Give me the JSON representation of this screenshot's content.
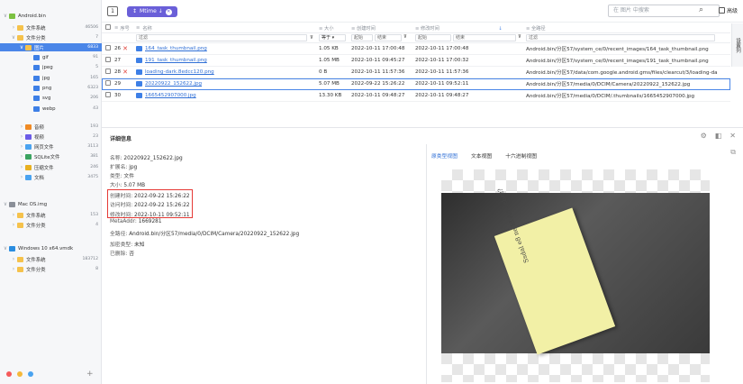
{
  "sidebar": {
    "tree": [
      {
        "label": "Android.bin",
        "count": "",
        "indent": 0,
        "chev": "∨",
        "icon": "android",
        "selected": false
      },
      {
        "label": "文件系统",
        "count": "46506",
        "indent": 1,
        "chev": "›",
        "icon": "folder",
        "selected": false
      },
      {
        "label": "文件分类",
        "count": "7",
        "indent": 1,
        "chev": "∨",
        "icon": "folder",
        "selected": false
      },
      {
        "label": "图片",
        "count": "6833",
        "indent": 2,
        "chev": "∨",
        "icon": "folder",
        "selected": true
      },
      {
        "label": "gif",
        "count": "91",
        "indent": 3,
        "chev": "",
        "icon": "image",
        "selected": false
      },
      {
        "label": "jpeg",
        "count": "5",
        "indent": 3,
        "chev": "",
        "icon": "image",
        "selected": false
      },
      {
        "label": "jpg",
        "count": "165",
        "indent": 3,
        "chev": "",
        "icon": "image",
        "selected": false
      },
      {
        "label": "png",
        "count": "6323",
        "indent": 3,
        "chev": "",
        "icon": "image",
        "selected": false
      },
      {
        "label": "svg",
        "count": "206",
        "indent": 3,
        "chev": "",
        "icon": "image",
        "selected": false
      },
      {
        "label": "webp",
        "count": "43",
        "indent": 3,
        "chev": "",
        "icon": "image",
        "selected": false
      },
      {
        "label": "音频",
        "count": "193",
        "indent": 2,
        "chev": "›",
        "icon": "audio",
        "selected": false
      },
      {
        "label": "视频",
        "count": "23",
        "indent": 2,
        "chev": "›",
        "icon": "video",
        "selected": false
      },
      {
        "label": "网页文件",
        "count": "3113",
        "indent": 2,
        "chev": "›",
        "icon": "web",
        "selected": false
      },
      {
        "label": "SQLite文件",
        "count": "381",
        "indent": 2,
        "chev": "›",
        "icon": "sqlite",
        "selected": false
      },
      {
        "label": "压缩文件",
        "count": "246",
        "indent": 2,
        "chev": "›",
        "icon": "zip",
        "selected": false
      },
      {
        "label": "文档",
        "count": "3475",
        "indent": 2,
        "chev": "›",
        "icon": "doc",
        "selected": false
      },
      {
        "label": "Mac OS.img",
        "count": "",
        "indent": 0,
        "chev": "∨",
        "icon": "mac",
        "selected": false
      },
      {
        "label": "文件系统",
        "count": "153",
        "indent": 1,
        "chev": "›",
        "icon": "folder",
        "selected": false
      },
      {
        "label": "文件分类",
        "count": "4",
        "indent": 1,
        "chev": "›",
        "icon": "folder",
        "selected": false
      },
      {
        "label": "Windows 10 x64.vmdk",
        "count": "",
        "indent": 0,
        "chev": "∨",
        "icon": "windows",
        "selected": false
      },
      {
        "label": "文件系统",
        "count": "183712",
        "indent": 1,
        "chev": "›",
        "icon": "folder",
        "selected": false
      },
      {
        "label": "文件分类",
        "count": "8",
        "indent": 1,
        "chev": "›",
        "icon": "folder",
        "selected": false
      }
    ],
    "add_label": "+"
  },
  "toolbar": {
    "view_toggle": "1",
    "filter_chip": "Mtime ↓",
    "search_placeholder": "在 图片 中搜索",
    "adv_search": "高级"
  },
  "table": {
    "headers": {
      "index": "序号",
      "name": "名称",
      "size": "大小",
      "ctime": "创建时间",
      "mtime": "修改时间",
      "path": "全路径"
    },
    "filters": {
      "name": "过滤",
      "size_op": "等于 ▾",
      "start": "起始",
      "end": "结束",
      "path": "过滤"
    },
    "rows": [
      {
        "index": "26",
        "deleted": true,
        "name": "164_task_thumbnail.png",
        "size": "1.05 KB",
        "ctime": "2022-10-11 17:00:48",
        "mtime": "2022-10-11 17:00:48",
        "path": "Android.bin/分区57/system_ce/0/recent_images/164_task_thumbnail.png",
        "selected": false
      },
      {
        "index": "27",
        "deleted": false,
        "name": "191_task_thumbnail.png",
        "size": "1.05 MB",
        "ctime": "2022-10-11 09:45:27",
        "mtime": "2022-10-11 17:00:32",
        "path": "Android.bin/分区57/system_ce/0/recent_images/191_task_thumbnail.png",
        "selected": false
      },
      {
        "index": "28",
        "deleted": true,
        "name": "loading-dark.8edcc120.png",
        "size": "0 B",
        "ctime": "2022-10-11 11:57:36",
        "mtime": "2022-10-11 11:57:36",
        "path": "Android.bin/分区57/data/com.google.android.gms/files/clearcut/3/loading-da",
        "selected": false
      },
      {
        "index": "29",
        "deleted": false,
        "name": "20220922_152622.jpg",
        "size": "5.07 MB",
        "ctime": "2022-09-22 15:26:22",
        "mtime": "2022-10-11 09:52:11",
        "path": "Android.bin/分区57/media/0/DCIM/Camera/20220922_152622.jpg",
        "selected": true
      },
      {
        "index": "30",
        "deleted": false,
        "name": "1665452907000.jpg",
        "size": "13.30 KB",
        "ctime": "2022-10-11 09:48:27",
        "mtime": "2022-10-11 09:48:27",
        "path": "Android.bin/分区57/media/0/DCIM/.thumbnails/1665452907000.jpg",
        "selected": false
      }
    ],
    "side_tab": "设置列"
  },
  "details": {
    "title": "详细信息",
    "props": [
      {
        "k": "名称:",
        "v": "20220922_152622.jpg"
      },
      {
        "k": "扩展名:",
        "v": "jpg"
      },
      {
        "k": "类型:",
        "v": "文件"
      },
      {
        "k": "大小:",
        "v": "5.07 MB"
      },
      {
        "k": "创建时间:",
        "v": "2022-09-22 15:26:22"
      },
      {
        "k": "访问时间:",
        "v": "2022-09-22 15:26:22"
      },
      {
        "k": "修改时间:",
        "v": "2022-10-11 09:52:11"
      },
      {
        "k": "MetaAddr:",
        "v": "1669281"
      },
      {
        "k": "全路径:",
        "v": "Android.bin/分区57/media/0/DCIM/Camera/20220922_152622.jpg"
      },
      {
        "k": "加密类型:",
        "v": "未知"
      },
      {
        "k": "已删除:",
        "v": "否"
      }
    ],
    "preview_tabs": [
      "原类型视图",
      "文本视图",
      "十六进制视图"
    ],
    "note_text": "Ssdal e8 ne fd Ab ozbzz?"
  },
  "colors": {
    "accent": "#4a86e8",
    "chip": "#6a5fd8",
    "highlight": "#e53935",
    "dots": [
      "#f55a5a",
      "#f5b83a",
      "#4aa3f0"
    ]
  }
}
